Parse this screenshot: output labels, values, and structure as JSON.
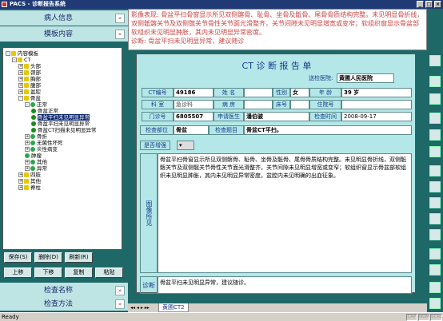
{
  "window": {
    "title": "PACS - 诊断报告系统"
  },
  "left": {
    "section_patient": "病人信息",
    "section_template": "模板内容",
    "tree": [
      {
        "label": "内容模板",
        "indent": 0,
        "toggle": "-",
        "icon": "y"
      },
      {
        "label": "CT",
        "indent": 1,
        "toggle": "-",
        "icon": "y"
      },
      {
        "label": "头部",
        "indent": 2,
        "toggle": "+",
        "icon": "y"
      },
      {
        "label": "颈部",
        "indent": 2,
        "toggle": "+",
        "icon": "y"
      },
      {
        "label": "胸部",
        "indent": 2,
        "toggle": "+",
        "icon": "y"
      },
      {
        "label": "腹部",
        "indent": 2,
        "toggle": "+",
        "icon": "y"
      },
      {
        "label": "盆腔",
        "indent": 2,
        "toggle": "+",
        "icon": "y"
      },
      {
        "label": "骨盆",
        "indent": 2,
        "toggle": "-",
        "icon": "y"
      },
      {
        "label": "正常",
        "indent": 3,
        "toggle": "-",
        "icon": "g"
      },
      {
        "label": "骨盆正常",
        "indent": 4,
        "toggle": "",
        "icon": "n"
      },
      {
        "label": "骨盆平扫未见明显异常",
        "indent": 4,
        "toggle": "",
        "icon": "n",
        "selected": true
      },
      {
        "label": "骨盆平扫未见明显异常",
        "indent": 4,
        "toggle": "",
        "icon": "n"
      },
      {
        "label": "骨盆CT扫描未见明显异常",
        "indent": 4,
        "toggle": "",
        "icon": "n"
      },
      {
        "label": "骨折",
        "indent": 3,
        "toggle": "+",
        "icon": "g"
      },
      {
        "label": "无菌性坏死",
        "indent": 3,
        "toggle": "+",
        "icon": "g"
      },
      {
        "label": "炎性病变",
        "indent": 3,
        "toggle": "+",
        "icon": "g"
      },
      {
        "label": "肿瘤",
        "indent": 3,
        "toggle": "",
        "icon": "g"
      },
      {
        "label": "其他",
        "indent": 3,
        "toggle": "+",
        "icon": "g"
      },
      {
        "label": "异常",
        "indent": 3,
        "toggle": "+",
        "icon": "g"
      },
      {
        "label": "四肢",
        "indent": 2,
        "toggle": "+",
        "icon": "y"
      },
      {
        "label": "其他",
        "indent": 2,
        "toggle": "+",
        "icon": "y"
      },
      {
        "label": "脊柱",
        "indent": 2,
        "toggle": "+",
        "icon": "y"
      }
    ],
    "btn_save": "保存(S)",
    "btn_delete": "删除(D)",
    "btn_refresh": "刷新(R)",
    "btn_up": "上移",
    "btn_down": "下移",
    "btn_copy": "复制",
    "btn_paste": "粘贴",
    "section_exam_name": "检查名称",
    "section_exam_method": "检查方法"
  },
  "description": {
    "label1": "影像表现:",
    "text1": "骨盆平扫骨窗显示所见双侧髂骨、耻骨、坐骨及骶骨、尾骨骨质结构完整。未见明显骨折线，双侧骶髂关节及双侧髋关节骨性关节面光滑整齐，关节间隙未见明显增宽或变窄；软组织窗显示骨盆部软组织未见明显肿胀，其内未见明显异常密度。",
    "label2": "诊断:",
    "text2": "骨盆平扫未见明显异常，建议随诊"
  },
  "report": {
    "title": "CT 诊 断 报 告 单",
    "hospital_label": "送检医院:",
    "hospital_value": "黄圃人民医院",
    "ct_no_label": "CT编号",
    "ct_no": "49186",
    "name_label": "姓  名",
    "name_value": "",
    "sex_label": "性别",
    "sex_value": "女",
    "age_label": "年  龄",
    "age_value": "39 岁",
    "dept_label": "科  室",
    "dept_value": "急诊科",
    "ward_label": "病  房",
    "ward_value": "",
    "bed_label": "床号",
    "bed_value": "",
    "inpatient_label": "住院号",
    "inpatient_value": "",
    "outpatient_label": "门诊号",
    "outpatient_value": "6805507",
    "doctor_label": "申请医生",
    "doctor_value": "潘伯骏",
    "exam_time_label": "检查时间",
    "exam_time_value": "2008-09-17",
    "exam_part_label": "检查部位",
    "exam_part_value": "骨盆",
    "exam_item_label": "检查题目",
    "exam_item_value": "骨盆CT平扫。",
    "enhance_label": "是否增强",
    "findings_label": "图像所见",
    "findings_text": "骨盆平扫骨窗显示所见双侧髂骨、耻骨、坐骨及骶骨、尾骨骨质结构完整。未见明显骨折线，双侧骶髂关节及双侧髋关节骨性关节面光滑整齐，关节间隙未见明显增宽或变窄；软组织窗显示骨盆部软组织未见明显肿胀，其内未见明显异常密度。盆腔内未见明确的出血征象。",
    "diagnosis_label": "诊断",
    "diagnosis_text": "骨盆平扫未见明显异常，建议随诊。"
  },
  "tabs": {
    "active": "黄圃CT2"
  },
  "status": {
    "text": "Ready",
    "caps": "CAP",
    "num": "NUM",
    "scrl": "SCRL"
  }
}
